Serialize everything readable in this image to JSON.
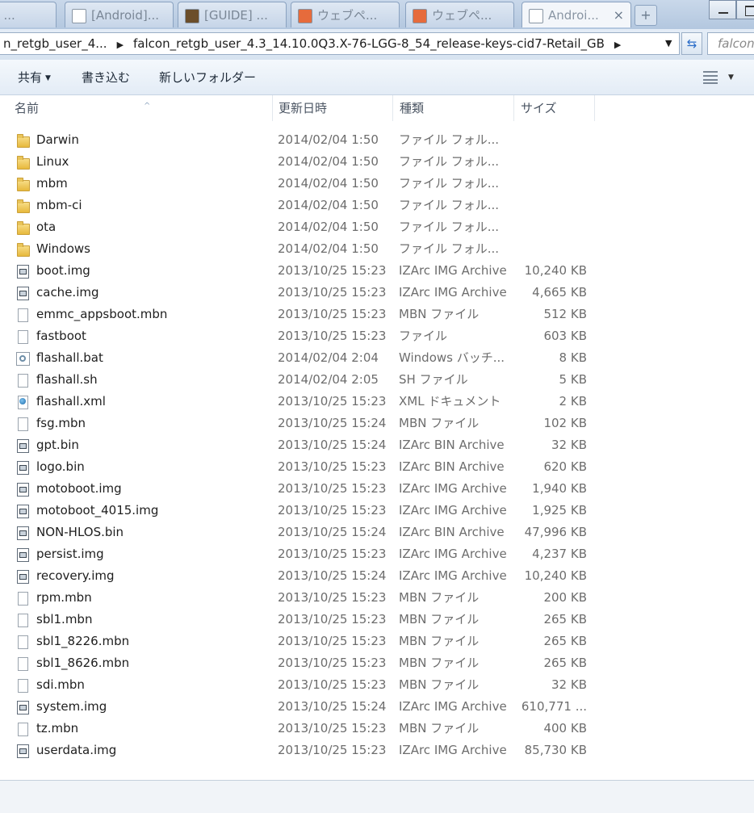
{
  "tabs": [
    {
      "label": "roid ...",
      "favicon_color": "#5a6b7e"
    },
    {
      "label": "[Android]...",
      "favicon_color": "#ffffff"
    },
    {
      "label": "[GUIDE] ...",
      "favicon_color": "#6b4e2a"
    },
    {
      "label": "ウェブペ...",
      "favicon_color": "#e66b3c"
    },
    {
      "label": "ウェブペ...",
      "favicon_color": "#e66b3c"
    },
    {
      "label": "Androi...",
      "favicon_color": "#ffffff"
    }
  ],
  "tab_close": "×",
  "new_tab": "+",
  "address": {
    "crumbs": [
      "n_retgb_user_4...",
      "falcon_retgb_user_4.3_14.10.0Q3.X-76-LGG-8_54_release-keys-cid7-Retail_GB"
    ],
    "separator": "▶",
    "dropdown": "▼",
    "refresh": "⇆",
    "search_placeholder": "falcon_"
  },
  "toolbar": {
    "share_label": "共有",
    "burn_label": "書き込む",
    "new_folder_label": "新しいフォルダー",
    "caret": "▼"
  },
  "columns": {
    "name": "名前",
    "date": "更新日時",
    "type": "種類",
    "size": "サイズ",
    "sort_indicator": "^"
  },
  "files": [
    {
      "name": "Darwin",
      "date": "2014/02/04 1:50",
      "type": "ファイル フォル...",
      "size": "",
      "icon": "folder-icon"
    },
    {
      "name": "Linux",
      "date": "2014/02/04 1:50",
      "type": "ファイル フォル...",
      "size": "",
      "icon": "folder-icon"
    },
    {
      "name": "mbm",
      "date": "2014/02/04 1:50",
      "type": "ファイル フォル...",
      "size": "",
      "icon": "folder-icon"
    },
    {
      "name": "mbm-ci",
      "date": "2014/02/04 1:50",
      "type": "ファイル フォル...",
      "size": "",
      "icon": "folder-icon"
    },
    {
      "name": "ota",
      "date": "2014/02/04 1:50",
      "type": "ファイル フォル...",
      "size": "",
      "icon": "folder-icon"
    },
    {
      "name": "Windows",
      "date": "2014/02/04 1:50",
      "type": "ファイル フォル...",
      "size": "",
      "icon": "folder-icon"
    },
    {
      "name": "boot.img",
      "date": "2013/10/25 15:23",
      "type": "IZArc IMG Archive",
      "size": "10,240 KB",
      "icon": "archive-icon"
    },
    {
      "name": "cache.img",
      "date": "2013/10/25 15:23",
      "type": "IZArc IMG Archive",
      "size": "4,665 KB",
      "icon": "archive-icon"
    },
    {
      "name": "emmc_appsboot.mbn",
      "date": "2013/10/25 15:23",
      "type": "MBN ファイル",
      "size": "512 KB",
      "icon": "file-icon"
    },
    {
      "name": "fastboot",
      "date": "2013/10/25 15:23",
      "type": "ファイル",
      "size": "603 KB",
      "icon": "file-icon"
    },
    {
      "name": "flashall.bat",
      "date": "2014/02/04 2:04",
      "type": "Windows バッチ...",
      "size": "8 KB",
      "icon": "batch-file-icon"
    },
    {
      "name": "flashall.sh",
      "date": "2014/02/04 2:05",
      "type": "SH ファイル",
      "size": "5 KB",
      "icon": "file-icon"
    },
    {
      "name": "flashall.xml",
      "date": "2013/10/25 15:23",
      "type": "XML ドキュメント",
      "size": "2 KB",
      "icon": "xml-document-icon"
    },
    {
      "name": "fsg.mbn",
      "date": "2013/10/25 15:24",
      "type": "MBN ファイル",
      "size": "102 KB",
      "icon": "file-icon"
    },
    {
      "name": "gpt.bin",
      "date": "2013/10/25 15:24",
      "type": "IZArc BIN Archive",
      "size": "32 KB",
      "icon": "archive-icon"
    },
    {
      "name": "logo.bin",
      "date": "2013/10/25 15:23",
      "type": "IZArc BIN Archive",
      "size": "620 KB",
      "icon": "archive-icon"
    },
    {
      "name": "motoboot.img",
      "date": "2013/10/25 15:23",
      "type": "IZArc IMG Archive",
      "size": "1,940 KB",
      "icon": "archive-icon"
    },
    {
      "name": "motoboot_4015.img",
      "date": "2013/10/25 15:23",
      "type": "IZArc IMG Archive",
      "size": "1,925 KB",
      "icon": "archive-icon"
    },
    {
      "name": "NON-HLOS.bin",
      "date": "2013/10/25 15:24",
      "type": "IZArc BIN Archive",
      "size": "47,996 KB",
      "icon": "archive-icon"
    },
    {
      "name": "persist.img",
      "date": "2013/10/25 15:23",
      "type": "IZArc IMG Archive",
      "size": "4,237 KB",
      "icon": "archive-icon"
    },
    {
      "name": "recovery.img",
      "date": "2013/10/25 15:24",
      "type": "IZArc IMG Archive",
      "size": "10,240 KB",
      "icon": "archive-icon"
    },
    {
      "name": "rpm.mbn",
      "date": "2013/10/25 15:23",
      "type": "MBN ファイル",
      "size": "200 KB",
      "icon": "file-icon"
    },
    {
      "name": "sbl1.mbn",
      "date": "2013/10/25 15:23",
      "type": "MBN ファイル",
      "size": "265 KB",
      "icon": "file-icon"
    },
    {
      "name": "sbl1_8226.mbn",
      "date": "2013/10/25 15:23",
      "type": "MBN ファイル",
      "size": "265 KB",
      "icon": "file-icon"
    },
    {
      "name": "sbl1_8626.mbn",
      "date": "2013/10/25 15:23",
      "type": "MBN ファイル",
      "size": "265 KB",
      "icon": "file-icon"
    },
    {
      "name": "sdi.mbn",
      "date": "2013/10/25 15:23",
      "type": "MBN ファイル",
      "size": "32 KB",
      "icon": "file-icon"
    },
    {
      "name": "system.img",
      "date": "2013/10/25 15:24",
      "type": "IZArc IMG Archive",
      "size": "610,771 ...",
      "icon": "archive-icon"
    },
    {
      "name": "tz.mbn",
      "date": "2013/10/25 15:23",
      "type": "MBN ファイル",
      "size": "400 KB",
      "icon": "file-icon"
    },
    {
      "name": "userdata.img",
      "date": "2013/10/25 15:23",
      "type": "IZArc IMG Archive",
      "size": "85,730 KB",
      "icon": "archive-icon"
    }
  ]
}
